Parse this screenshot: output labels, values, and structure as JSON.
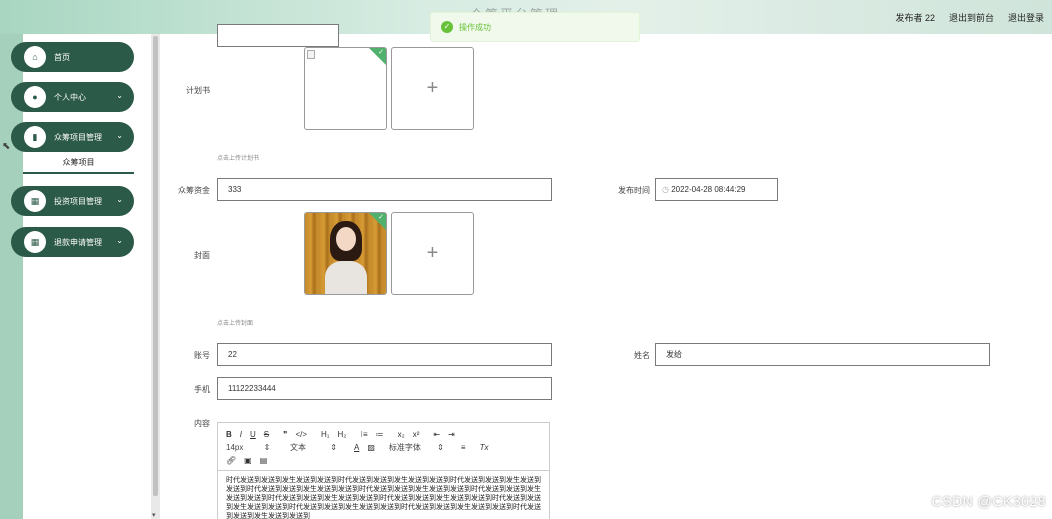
{
  "header": {
    "title": "众筹平台管理",
    "user_label": "发布者 22",
    "back_front_label": "退出到前台",
    "logout_label": "退出登录"
  },
  "toast": {
    "message": "操作成功"
  },
  "sidebar": {
    "items": [
      {
        "label": "首页",
        "icon": "home-icon"
      },
      {
        "label": "个人中心",
        "icon": "user-icon"
      },
      {
        "label": "众筹项目管理",
        "icon": "book-icon"
      },
      {
        "label": "投资项目管理",
        "icon": "grid-icon"
      },
      {
        "label": "退款申请管理",
        "icon": "grid-icon"
      }
    ],
    "submenu": {
      "label": "众筹项目"
    }
  },
  "form": {
    "plan_label": "计划书",
    "plan_tip": "点击上传计划书",
    "funds_label": "众筹资金",
    "funds_value": "333",
    "publish_time_label": "发布时间",
    "publish_time_value": "2022-04-28 08:44:29",
    "cover_label": "封面",
    "cover_tip": "点击上传封面",
    "account_label": "账号",
    "account_value": "22",
    "name_label": "姓名",
    "name_value": "发给",
    "phone_label": "手机",
    "phone_value": "11122233444",
    "content_label": "内容"
  },
  "editor": {
    "toolbar_row1": [
      "B",
      "I",
      "U",
      "S",
      "❞",
      "</>",
      "H₁",
      "H₂",
      "⁝≡",
      "≔",
      "x₂",
      "x²",
      "⇤",
      "⇥"
    ],
    "font_size": "14px",
    "text_style": "文本",
    "font_color_icon": "A",
    "highlight_icon": "",
    "font_family": "标准字体",
    "align_icon": "≡",
    "clear_icon": "Tx",
    "content": "时代发送到发送到发生发送到发送到时代发送到发送到发生发送到发送到时代发送到发送到发生发送到发送到时代发送到发送到发生发送到发送到时代发送到发送到发生发送到发送到时代发送到发送到发生发送到发送到时代发送到发送到发生发送到发送到时代发送到发送到发生发送到发送到时代发送到发送到发生发送到发送到时代发送到发送到发生发送到发送到时代发送到发送到发生发送到发送到时代发送到发送到发生发送到发送到"
  },
  "watermark": "CSDN @CK3028"
}
